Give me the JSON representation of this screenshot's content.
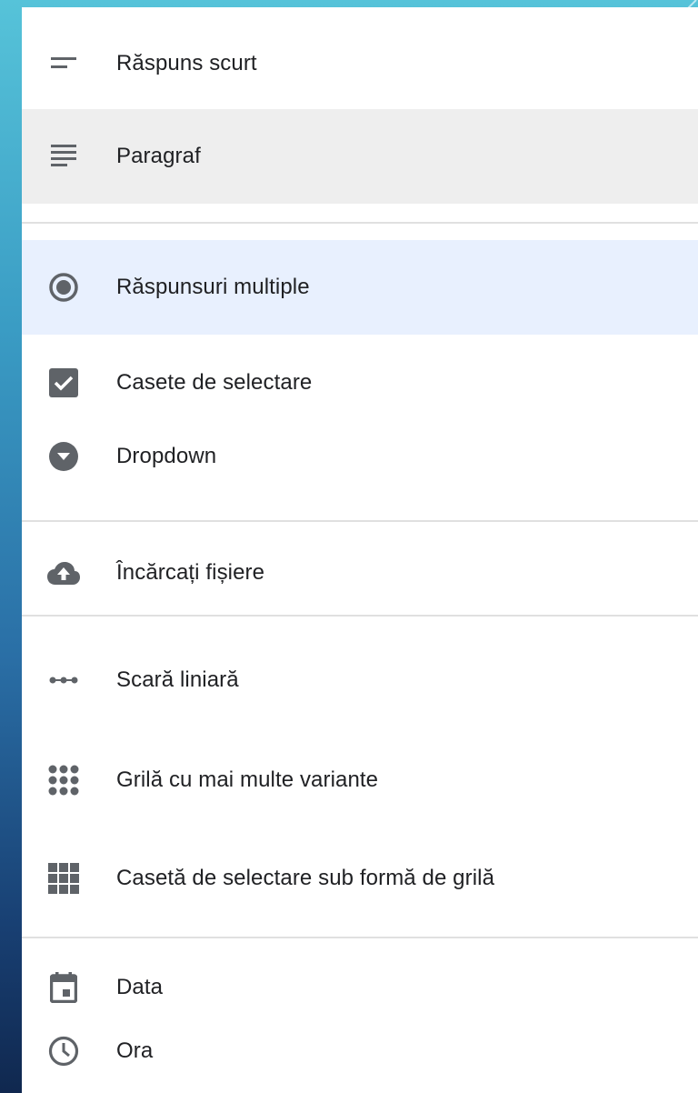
{
  "menu": {
    "items": [
      {
        "label": "Răspuns scurt",
        "icon": "short-text-icon"
      },
      {
        "label": "Paragraf",
        "icon": "paragraph-icon"
      },
      {
        "label": "Răspunsuri multiple",
        "icon": "radio-button-icon"
      },
      {
        "label": "Casete de selectare",
        "icon": "checkbox-icon"
      },
      {
        "label": "Dropdown",
        "icon": "dropdown-icon"
      },
      {
        "label": "Încărcați fișiere",
        "icon": "cloud-upload-icon"
      },
      {
        "label": "Scară liniară",
        "icon": "linear-scale-icon"
      },
      {
        "label": "Grilă cu mai multe variante",
        "icon": "multiple-choice-grid-icon"
      },
      {
        "label": "Casetă de selectare sub formă de grilă",
        "icon": "checkbox-grid-icon"
      },
      {
        "label": "Data",
        "icon": "calendar-icon"
      },
      {
        "label": "Ora",
        "icon": "clock-icon"
      }
    ],
    "hovered_item": "Paragraf",
    "selected_item": "Răspunsuri multiple"
  },
  "colors": {
    "icon": "#5f6368",
    "selected_background": "#e8f0fe",
    "hover_background": "#eeeeee",
    "divider": "#e0e0e0"
  }
}
